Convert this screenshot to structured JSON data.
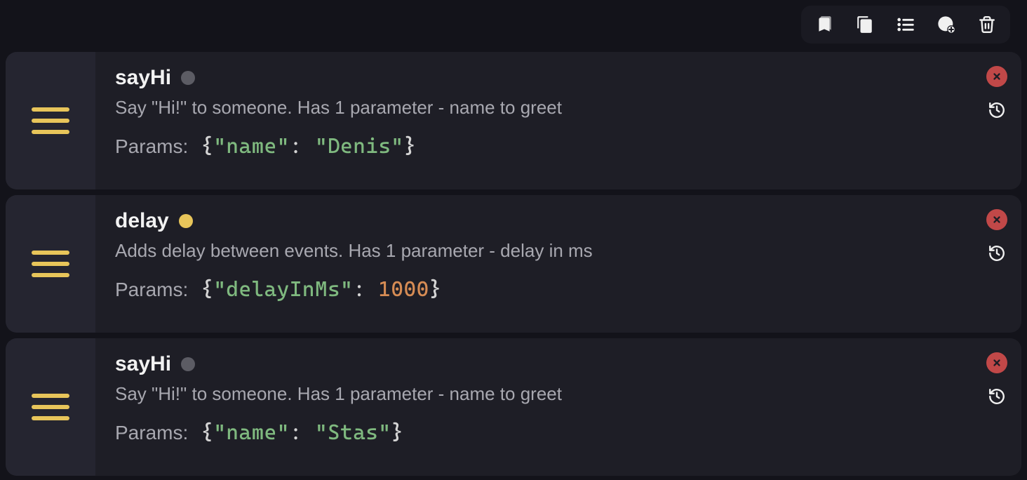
{
  "toolbar": {
    "icons": [
      "bookmark",
      "copy",
      "list",
      "add-circle",
      "trash"
    ]
  },
  "params_label": "Params:",
  "rows": [
    {
      "title": "sayHi",
      "status": "gray",
      "description": "Say \"Hi!\" to someone. Has 1 parameter - name to greet",
      "params": {
        "type": "object",
        "key": "name",
        "valueType": "string",
        "value": "Denis"
      }
    },
    {
      "title": "delay",
      "status": "yellow",
      "description": "Adds delay between events. Has 1 parameter - delay in ms",
      "params": {
        "type": "object",
        "key": "delayInMs",
        "valueType": "number",
        "value": "1000"
      }
    },
    {
      "title": "sayHi",
      "status": "gray",
      "description": "Say \"Hi!\" to someone. Has 1 parameter - name to greet",
      "params": {
        "type": "object",
        "key": "name",
        "valueType": "string",
        "value": "Stas"
      }
    }
  ]
}
